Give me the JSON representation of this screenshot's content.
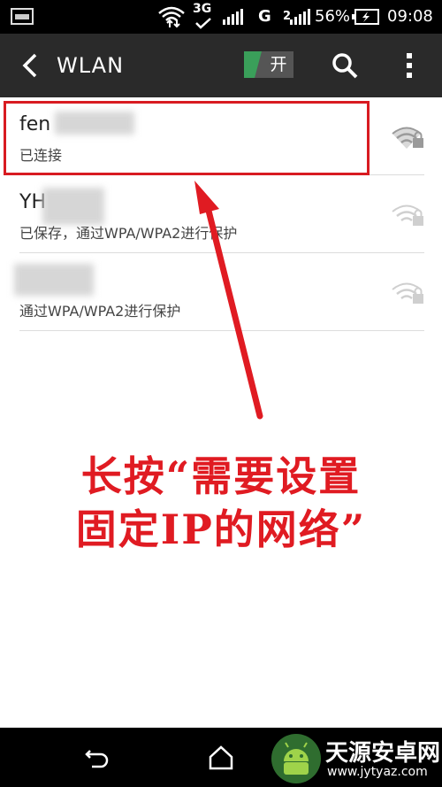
{
  "status_bar": {
    "network_3g": "3G",
    "network_g": "G",
    "carrier_prefix": "2",
    "battery_pct": "56%",
    "time": "09:08"
  },
  "app_bar": {
    "title": "WLAN",
    "toggle_label": "开"
  },
  "networks": [
    {
      "name": "fen",
      "status": "已连接",
      "secured": true
    },
    {
      "name": "YH",
      "status": "已保存，通过WPA/WPA2进行保护",
      "secured": false
    },
    {
      "name": "",
      "status": "通过WPA/WPA2进行保护",
      "secured": false
    }
  ],
  "annotation": {
    "line1": "长按“需要设置",
    "line2": "固定IP的网络”"
  },
  "watermark": {
    "title": "天源安卓网",
    "url": "www.jytyaz.com"
  },
  "colors": {
    "highlight": "#d81b21",
    "annotation_text": "#e01b22",
    "toggle_on": "#3a9f5a"
  }
}
